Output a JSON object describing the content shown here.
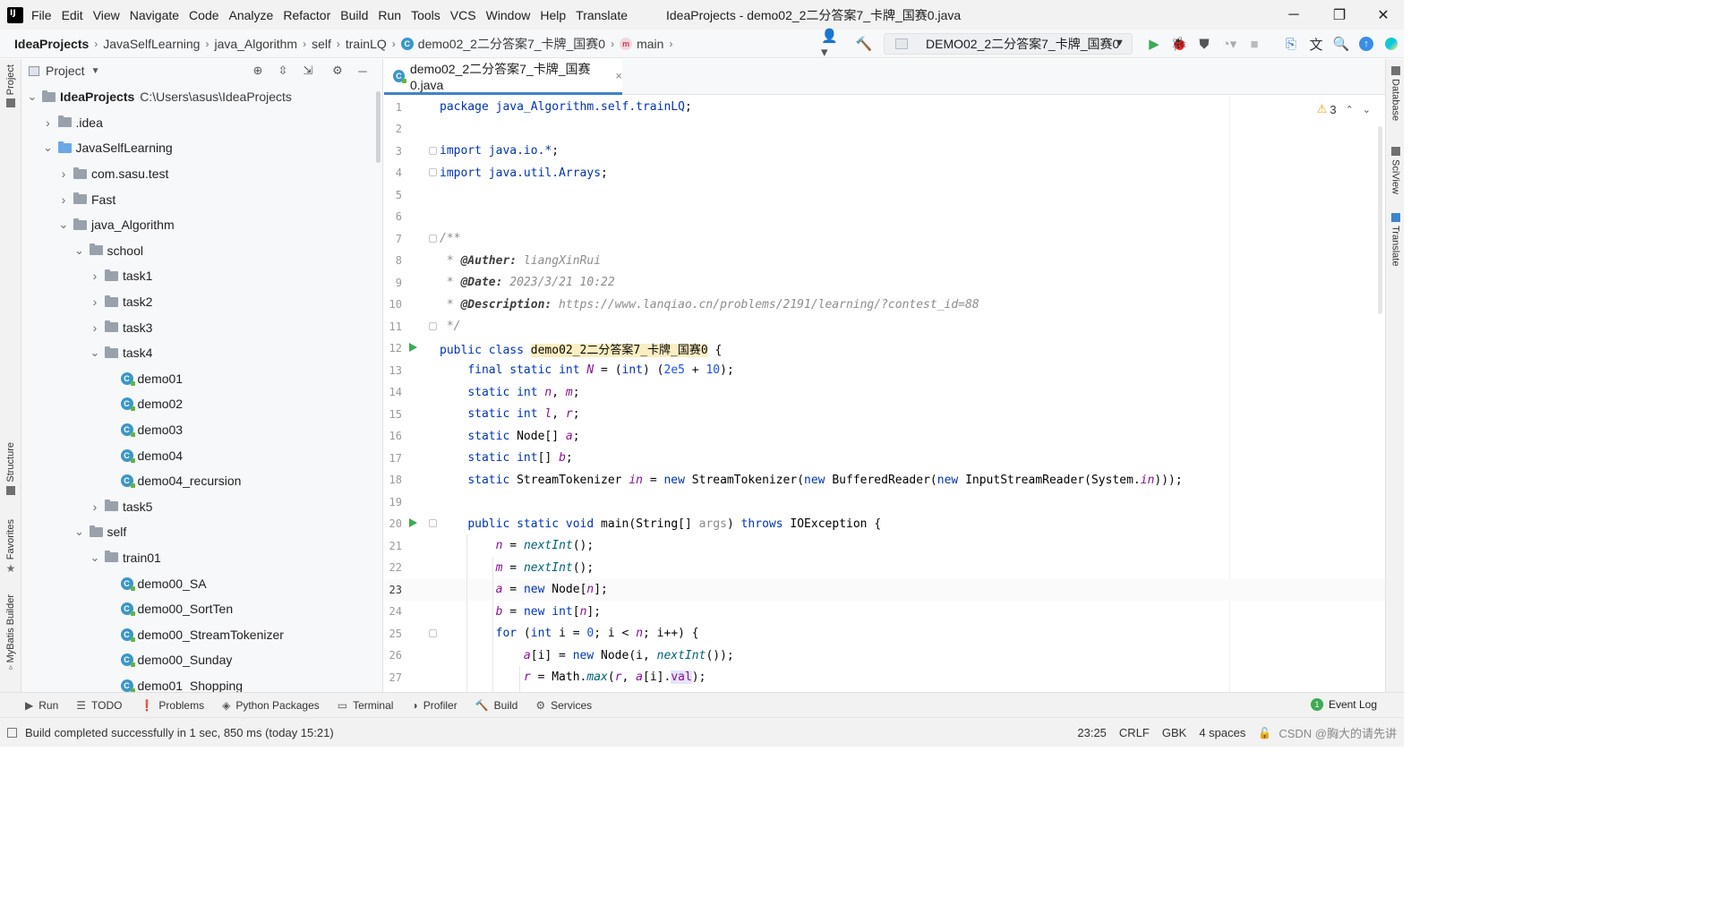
{
  "app": {
    "window_title": "IdeaProjects - demo02_2二分答案7_卡牌_国赛0.java",
    "logo": "IJ",
    "menu": [
      "File",
      "Edit",
      "View",
      "Navigate",
      "Code",
      "Analyze",
      "Refactor",
      "Build",
      "Run",
      "Tools",
      "VCS",
      "Window",
      "Help",
      "Translate"
    ],
    "window_controls": {
      "minimize": "─",
      "restore": "❐",
      "close": "✕"
    }
  },
  "breadcrumb": {
    "items": [
      "IdeaProjects",
      "JavaSelfLearning",
      "java_Algorithm",
      "self",
      "trainLQ",
      "demo02_2二分答案7_卡牌_国赛0",
      "main"
    ],
    "separator": "›",
    "class_icon": "C",
    "method_icon": "m"
  },
  "toolbar": {
    "run_config": "DEMO02_2二分答案7_卡牌_国赛0",
    "icons": [
      "user-icon",
      "hammer-icon",
      "run-icon",
      "debug-icon",
      "coverage-icon",
      "profile-icon",
      "stop-icon",
      "translate-doc-icon",
      "translate-icon",
      "search-icon",
      "update-icon",
      "jetbrains-icon"
    ]
  },
  "left_strip": {
    "tabs": [
      "Project",
      "Structure",
      "Favorites",
      "MyBatis Builder"
    ]
  },
  "project_panel": {
    "title": "Project",
    "tree": [
      {
        "label": "IdeaProjects",
        "path": "C:\\Users\\asus\\IdeaProjects",
        "depth": 0,
        "type": "project",
        "expanded": true
      },
      {
        "label": ".idea",
        "depth": 1,
        "type": "folder",
        "expanded": false
      },
      {
        "label": "JavaSelfLearning",
        "depth": 1,
        "type": "module",
        "expanded": true
      },
      {
        "label": "com.sasu.test",
        "depth": 2,
        "type": "folder",
        "expanded": false
      },
      {
        "label": "Fast",
        "depth": 2,
        "type": "folder",
        "expanded": false
      },
      {
        "label": "java_Algorithm",
        "depth": 2,
        "type": "folder",
        "expanded": true
      },
      {
        "label": "school",
        "depth": 3,
        "type": "folder",
        "expanded": true
      },
      {
        "label": "task1",
        "depth": 4,
        "type": "folder",
        "expanded": false
      },
      {
        "label": "task2",
        "depth": 4,
        "type": "folder",
        "expanded": false
      },
      {
        "label": "task3",
        "depth": 4,
        "type": "folder",
        "expanded": false
      },
      {
        "label": "task4",
        "depth": 4,
        "type": "folder",
        "expanded": true
      },
      {
        "label": "demo01",
        "depth": 5,
        "type": "class"
      },
      {
        "label": "demo02",
        "depth": 5,
        "type": "class"
      },
      {
        "label": "demo03",
        "depth": 5,
        "type": "class"
      },
      {
        "label": "demo04",
        "depth": 5,
        "type": "class"
      },
      {
        "label": "demo04_recursion",
        "depth": 5,
        "type": "class"
      },
      {
        "label": "task5",
        "depth": 4,
        "type": "folder",
        "expanded": false
      },
      {
        "label": "self",
        "depth": 3,
        "type": "folder",
        "expanded": true
      },
      {
        "label": "train01",
        "depth": 4,
        "type": "folder",
        "expanded": true
      },
      {
        "label": "demo00_SA",
        "depth": 5,
        "type": "class"
      },
      {
        "label": "demo00_SortTen",
        "depth": 5,
        "type": "class"
      },
      {
        "label": "demo00_StreamTokenizer",
        "depth": 5,
        "type": "class"
      },
      {
        "label": "demo00_Sunday",
        "depth": 5,
        "type": "class"
      },
      {
        "label": "demo01_Shopping",
        "depth": 5,
        "type": "class"
      }
    ]
  },
  "editor": {
    "tab_label": "demo02_2二分答案7_卡牌_国赛0.java",
    "tab_close": "×",
    "warnings": "3",
    "current_line": 23,
    "lines": [
      {
        "n": 1,
        "code": "package java_Algorithm.self.trainLQ;"
      },
      {
        "n": 2,
        "code": ""
      },
      {
        "n": 3,
        "code": "import java.io.*;",
        "fold": true
      },
      {
        "n": 4,
        "code": "import java.util.Arrays;",
        "fold": true
      },
      {
        "n": 5,
        "code": ""
      },
      {
        "n": 6,
        "code": ""
      },
      {
        "n": 7,
        "code": "/**",
        "fold": true
      },
      {
        "n": 8,
        "code": " * @Auther: liangXinRui"
      },
      {
        "n": 9,
        "code": " * @Date: 2023/3/21 10:22"
      },
      {
        "n": 10,
        "code": " * @Description: https://www.lanqiao.cn/problems/2191/learning/?contest_id=88"
      },
      {
        "n": 11,
        "code": " */",
        "fold": true
      },
      {
        "n": 12,
        "code": "public class demo02_2二分答案7_卡牌_国赛0 {",
        "run": true
      },
      {
        "n": 13,
        "code": "    final static int N = (int) (2e5 + 10);"
      },
      {
        "n": 14,
        "code": "    static int n, m;"
      },
      {
        "n": 15,
        "code": "    static int l, r;"
      },
      {
        "n": 16,
        "code": "    static Node[] a;"
      },
      {
        "n": 17,
        "code": "    static int[] b;"
      },
      {
        "n": 18,
        "code": "    static StreamTokenizer in = new StreamTokenizer(new BufferedReader(new InputStreamReader(System.in)));"
      },
      {
        "n": 19,
        "code": ""
      },
      {
        "n": 20,
        "code": "    public static void main(String[] args) throws IOException {",
        "run": true,
        "fold": true
      },
      {
        "n": 21,
        "code": "        n = nextInt();"
      },
      {
        "n": 22,
        "code": "        m = nextInt();"
      },
      {
        "n": 23,
        "code": "        a = new Node[n];"
      },
      {
        "n": 24,
        "code": "        b = new int[n];"
      },
      {
        "n": 25,
        "code": "        for (int i = 0; i < n; i++) {",
        "fold": true
      },
      {
        "n": 26,
        "code": "            a[i] = new Node(i, nextInt());"
      },
      {
        "n": 27,
        "code": "            r = Math.max(r, a[i].val);"
      }
    ]
  },
  "right_strip": {
    "tabs": [
      "Database",
      "SciView",
      "Translate"
    ]
  },
  "bottom_tools": [
    {
      "label": "Run",
      "icon": "run-icon"
    },
    {
      "label": "TODO",
      "icon": "todo-icon"
    },
    {
      "label": "Problems",
      "icon": "problems-icon"
    },
    {
      "label": "Python Packages",
      "icon": "packages-icon"
    },
    {
      "label": "Terminal",
      "icon": "terminal-icon"
    },
    {
      "label": "Profiler",
      "icon": "profiler-icon"
    },
    {
      "label": "Build",
      "icon": "build-icon"
    },
    {
      "label": "Services",
      "icon": "services-icon"
    }
  ],
  "event_log": {
    "label": "Event Log",
    "count": "1"
  },
  "status_bar": {
    "message": "Build completed successfully in 1 sec, 850 ms (today 15:21)",
    "position": "23:25",
    "line_sep": "CRLF",
    "encoding": "GBK",
    "indent": "4 spaces",
    "watermark": "CSDN @胸大的请先讲"
  },
  "colors": {
    "accent": "#4083c9",
    "run_green": "#3dab52",
    "keyword": "#0033b3",
    "field": "#871094",
    "class_highlight": "#fbeec2"
  }
}
